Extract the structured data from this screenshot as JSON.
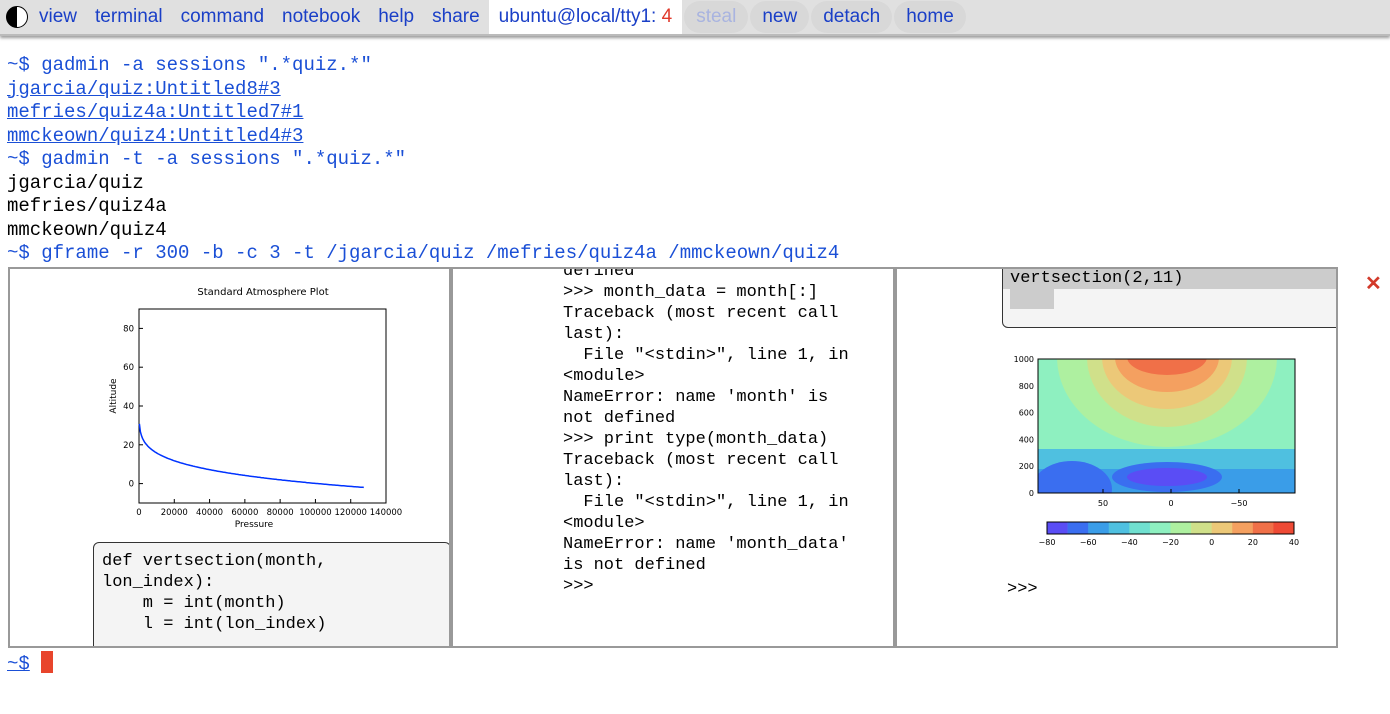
{
  "menubar": {
    "items": [
      "view",
      "terminal",
      "command",
      "notebook",
      "help",
      "share"
    ],
    "session": "ubuntu@local/tty1:",
    "session_count": "4",
    "buttons": [
      "steal",
      "new",
      "detach",
      "home"
    ]
  },
  "terminal": {
    "lines": [
      {
        "type": "cmd",
        "text": "~$ gadmin -a sessions \".*quiz.*\""
      },
      {
        "type": "link",
        "text": "jgarcia/quiz:Untitled8#3"
      },
      {
        "type": "link",
        "text": "mefries/quiz4a:Untitled7#1"
      },
      {
        "type": "link",
        "text": "mmckeown/quiz4:Untitled4#3"
      },
      {
        "type": "cmd",
        "text": "~$ gadmin -t -a sessions \".*quiz.*\""
      },
      {
        "type": "out",
        "text": "jgarcia/quiz"
      },
      {
        "type": "out",
        "text": "mefries/quiz4a"
      },
      {
        "type": "out",
        "text": "mmckeown/quiz4"
      },
      {
        "type": "cmd",
        "text": "~$ gframe -r 300 -b -c 3 -t /jgarcia/quiz /mefries/quiz4a /mmckeown/quiz4"
      }
    ],
    "prompt": "~$",
    "cursor_color": "#e8452c"
  },
  "frames": {
    "left": {
      "plot": {
        "title": "Standard Atmosphere Plot",
        "xlabel": "Pressure",
        "ylabel": "Altitude",
        "xticks": [
          "0",
          "20000",
          "40000",
          "60000",
          "80000",
          "100000",
          "120000",
          "140000"
        ],
        "yticks": [
          "0",
          "20",
          "40",
          "60",
          "80"
        ],
        "xlim": [
          0,
          140000
        ],
        "ylim": [
          -10,
          90
        ],
        "line_color": "#0033ff"
      },
      "cell_code": "def vertsection(month,\nlon_index):\n    m = int(month)\n    l = int(lon_index)"
    },
    "middle": {
      "text": "defined\n>>> month_data = month[:]\nTraceback (most recent call\nlast):\n  File \"<stdin>\", line 1, in\n<module>\nNameError: name 'month' is\nnot defined\n>>> print type(month_data)\nTraceback (most recent call\nlast):\n  File \"<stdin>\", line 1, in\n<module>\nNameError: name 'month_data'\nis not defined\n>>>"
    },
    "right": {
      "cell_code": "vertsection(2,11)",
      "plot": {
        "yticks": [
          "0",
          "200",
          "400",
          "600",
          "800",
          "1000"
        ],
        "xticks": [
          "50",
          "0",
          "−50"
        ],
        "colorbar_ticks": [
          "−80",
          "−60",
          "−40",
          "−20",
          "0",
          "20",
          "40"
        ],
        "colorbar_colors": [
          "#5a4df5",
          "#3a6ef0",
          "#3a9de8",
          "#4fc0e0",
          "#70e0d0",
          "#8ef0c0",
          "#aef0a0",
          "#d0e08a",
          "#ecc878",
          "#f4a060",
          "#f07048",
          "#ee4a35"
        ]
      },
      "prompt": ">>>"
    }
  },
  "close_icon_color": "#d23a2a"
}
